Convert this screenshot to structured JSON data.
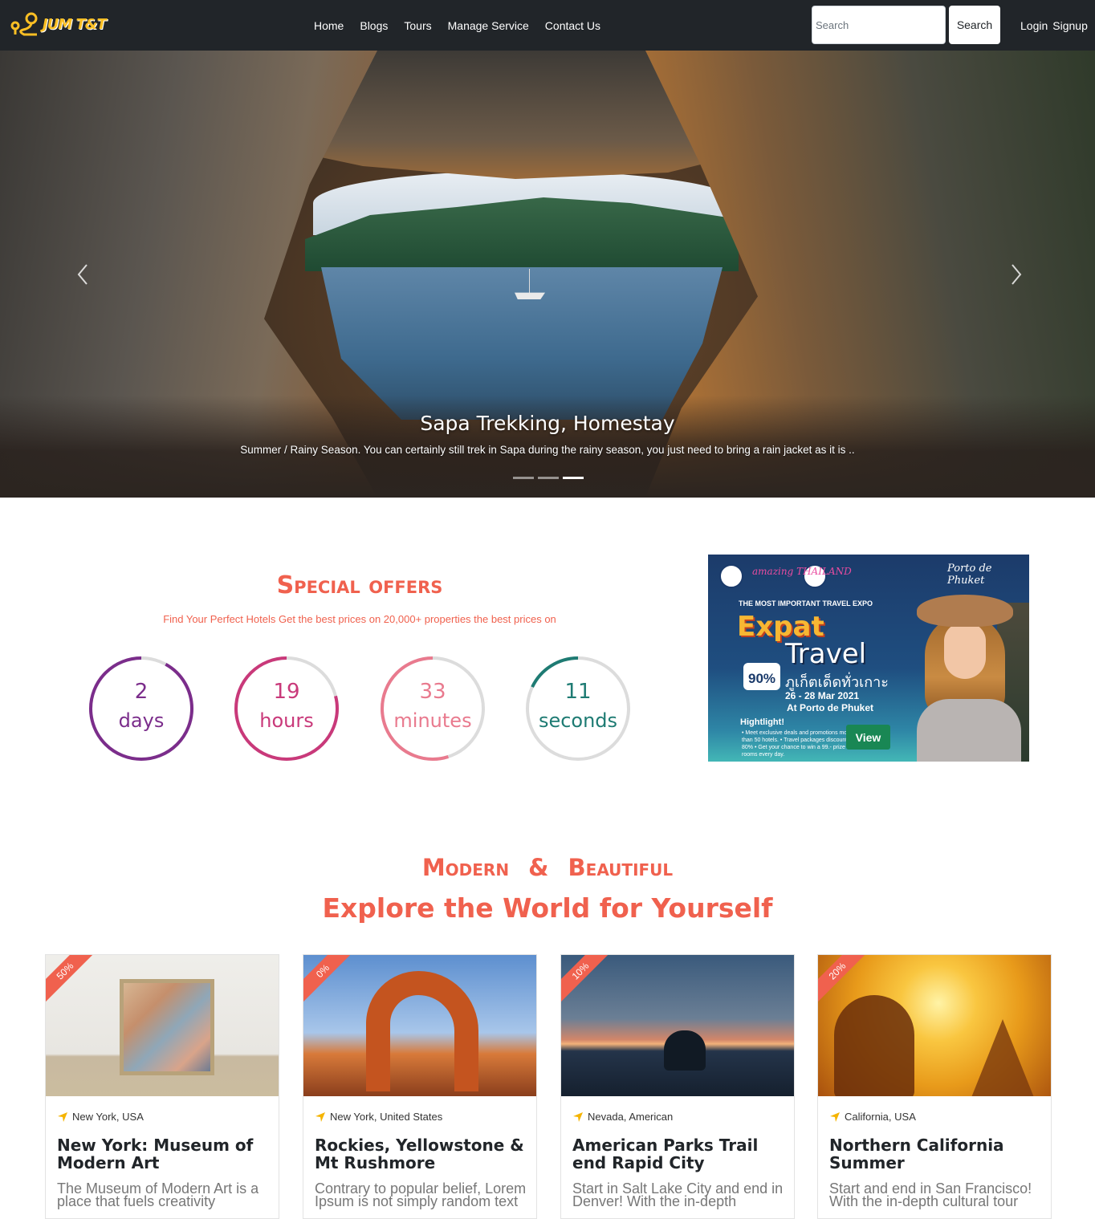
{
  "navbar": {
    "brand": "JUM T&T",
    "links": [
      "Home",
      "Blogs",
      "Tours",
      "Manage Service",
      "Contact Us"
    ],
    "search_placeholder": "Search",
    "search_button": "Search",
    "login": "Login",
    "signup": "Signup"
  },
  "hero": {
    "title": "Sapa Trekking, Homestay",
    "text": "Summer / Rainy Season. You can certainly still trek in Sapa during the rainy season, you just need to bring a rain jacket as it is ..",
    "slides": 3,
    "active_slide": 3
  },
  "offers": {
    "title": "Special offers",
    "subtitle": "Find Your Perfect Hotels Get the best prices on 20,000+ properties the best prices on",
    "countdown": [
      {
        "value": "2",
        "unit": "days",
        "color": "#7b2d8b",
        "fraction": 0.92
      },
      {
        "value": "19",
        "unit": "hours",
        "color": "#c9397a",
        "fraction": 0.79
      },
      {
        "value": "33",
        "unit": "minutes",
        "color": "#e97a8e",
        "fraction": 0.55
      },
      {
        "value": "11",
        "unit": "seconds",
        "color": "#1e7b73",
        "fraction": 0.18
      }
    ]
  },
  "ad": {
    "thailand": "amazing THAILAND",
    "porto": "Porto de Phuket",
    "expo": "THE MOST IMPORTANT TRAVEL EXPO",
    "expat": "Expat",
    "travel": "Travel",
    "offer": "90%",
    "thai": "ภูเก็ตเด็ดทั่วเกาะ",
    "date": "26 - 28 Mar 2021",
    "place": "At Porto de Phuket",
    "highlight": "Hightlight!",
    "bullets": "• Meet exclusive deals and promotions more than 50 hotels. • Travel packages discount up to 80% • Get your chance to win a 99.- prize for rooms every day.",
    "button": "View"
  },
  "explore": {
    "kicker": "Modern & Beautiful",
    "title": "Explore the World for Yourself",
    "cards": [
      {
        "discount": "50%",
        "location": "New York, USA",
        "title": "New York: Museum of Modern Art",
        "text": "The Museum of Modern Art is a place that fuels creativity"
      },
      {
        "discount": "0%",
        "location": "New York, United States",
        "title": "Rockies, Yellowstone & Mt Rushmore",
        "text": "Contrary to popular belief, Lorem Ipsum is not simply random text"
      },
      {
        "discount": "10%",
        "location": "Nevada, American",
        "title": "American Parks Trail end Rapid City",
        "text": "Start in Salt Lake City and end in Denver! With the in-depth"
      },
      {
        "discount": "20%",
        "location": "California, USA",
        "title": "Northern California Summer",
        "text": "Start and end in San Francisco! With the in-depth cultural tour"
      }
    ]
  },
  "colors": {
    "accent": "#f0614e",
    "navbar": "#212529",
    "view_button": "#198754",
    "location_icon": "#f5b400"
  },
  "icons": [
    "logo-pin-icon",
    "chevron-left-icon",
    "chevron-right-icon",
    "location-arrow-icon"
  ]
}
